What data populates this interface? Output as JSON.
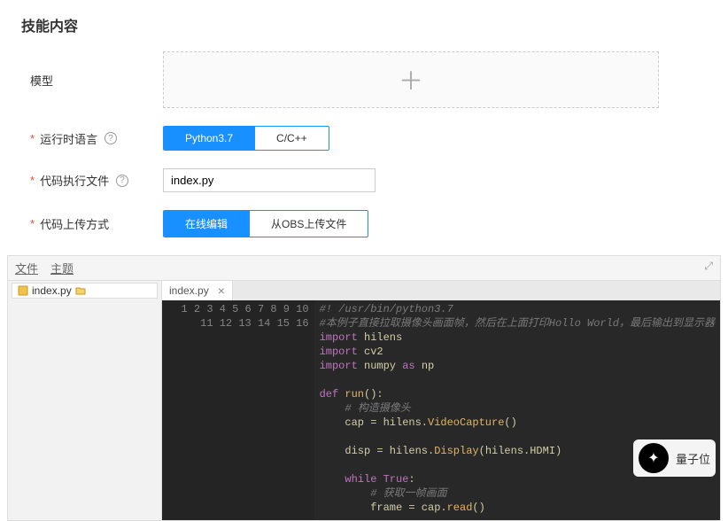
{
  "section_title": "技能内容",
  "rows": {
    "model": {
      "label": "模型"
    },
    "runtime": {
      "label": "运行时语言",
      "options": [
        "Python3.7",
        "C/C++"
      ],
      "selected": 0
    },
    "exec_file": {
      "label": "代码执行文件",
      "value": "index.py"
    },
    "upload_method": {
      "label": "代码上传方式",
      "options": [
        "在线编辑",
        "从OBS上传文件"
      ],
      "selected": 0
    }
  },
  "editor": {
    "menu": {
      "file": "文件",
      "theme": "主题"
    },
    "tree": {
      "filename": "index.py"
    },
    "tab": {
      "name": "index.py"
    },
    "code_lines": [
      {
        "n": 1,
        "seg": [
          [
            "comm",
            "#! /usr/bin/python3.7"
          ]
        ]
      },
      {
        "n": 2,
        "seg": [
          [
            "comm",
            "#本例子直接拉取摄像头画面帧，然后在上面打印Hollo World，最后输出到显示器"
          ]
        ]
      },
      {
        "n": 3,
        "seg": [
          [
            "key",
            "import "
          ],
          [
            "str",
            "hilens"
          ]
        ]
      },
      {
        "n": 4,
        "seg": [
          [
            "key",
            "import "
          ],
          [
            "str",
            "cv2"
          ]
        ]
      },
      {
        "n": 5,
        "seg": [
          [
            "key",
            "import "
          ],
          [
            "str",
            "numpy "
          ],
          [
            "key2",
            "as "
          ],
          [
            "str",
            "np"
          ]
        ]
      },
      {
        "n": 6,
        "seg": [
          [
            "",
            ""
          ]
        ]
      },
      {
        "n": 7,
        "seg": [
          [
            "key",
            "def "
          ],
          [
            "fn",
            "run"
          ],
          [
            "str",
            "():"
          ]
        ]
      },
      {
        "n": 8,
        "seg": [
          [
            "",
            "    "
          ],
          [
            "comm",
            "# 构造摄像头"
          ]
        ]
      },
      {
        "n": 9,
        "seg": [
          [
            "str",
            "    cap = hilens."
          ],
          [
            "fn",
            "VideoCapture"
          ],
          [
            "str",
            "()"
          ]
        ]
      },
      {
        "n": 10,
        "seg": [
          [
            "",
            ""
          ]
        ]
      },
      {
        "n": 11,
        "seg": [
          [
            "str",
            "    disp = hilens."
          ],
          [
            "fn",
            "Display"
          ],
          [
            "str",
            "(hilens."
          ],
          [
            "str",
            "HDMI"
          ],
          [
            "str",
            ")"
          ]
        ]
      },
      {
        "n": 12,
        "seg": [
          [
            "",
            ""
          ]
        ]
      },
      {
        "n": 13,
        "seg": [
          [
            "",
            "    "
          ],
          [
            "key",
            "while "
          ],
          [
            "key2",
            "True"
          ],
          [
            "str",
            ":"
          ]
        ]
      },
      {
        "n": 14,
        "seg": [
          [
            "",
            "        "
          ],
          [
            "comm",
            "# 获取一帧画面"
          ]
        ]
      },
      {
        "n": 15,
        "seg": [
          [
            "str",
            "        frame = cap."
          ],
          [
            "fn",
            "read"
          ],
          [
            "str",
            "()"
          ]
        ]
      },
      {
        "n": 16,
        "seg": [
          [
            "",
            ""
          ]
        ]
      }
    ]
  },
  "brand": "量子位"
}
